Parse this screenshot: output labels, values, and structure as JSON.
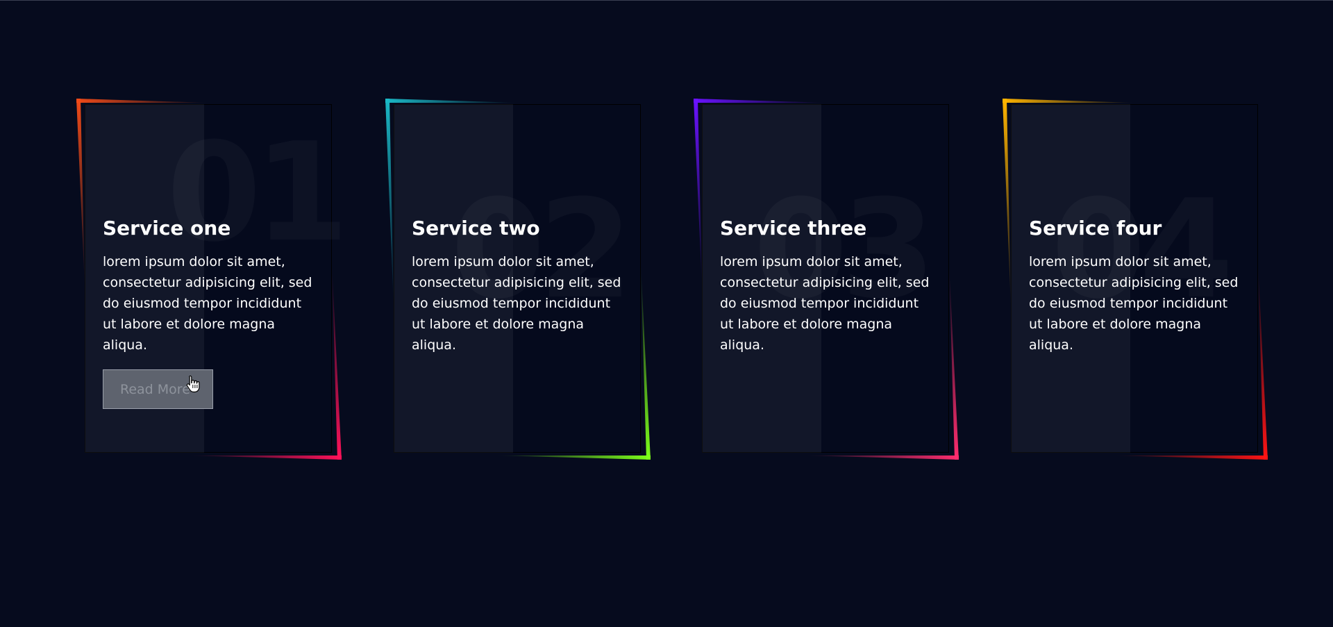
{
  "cards": [
    {
      "number": "01",
      "title": "Service one",
      "description": "lorem ipsum dolor sit amet, consectetur adipisicing elit, sed do eiusmod tempor incididunt ut labore et dolore magna aliqua.",
      "button_label": "Read More",
      "gradient": [
        "#f04a18",
        "#ff1f63"
      ],
      "start_color": "#f05a1e",
      "end_color": "#ff1259"
    },
    {
      "number": "02",
      "title": "Service two",
      "description": "lorem ipsum dolor sit amet, consectetur adipisicing elit, sed do eiusmod tempor incididunt ut labore et dolore magna aliqua.",
      "start_color": "#1ab8c6",
      "end_color": "#7dff1a"
    },
    {
      "number": "03",
      "title": "Service three",
      "description": "lorem ipsum dolor sit amet, consectetur adipisicing elit, sed do eiusmod tempor incididunt ut labore et dolore magna aliqua.",
      "start_color": "#6a12ff",
      "end_color": "#ff2d6e"
    },
    {
      "number": "04",
      "title": "Service four",
      "description": "lorem ipsum dolor sit amet, consectetur adipisicing elit, sed do eiusmod tempor incididunt ut labore et dolore magna aliqua.",
      "start_color": "#ffb400",
      "end_color": "#ff1414"
    }
  ]
}
